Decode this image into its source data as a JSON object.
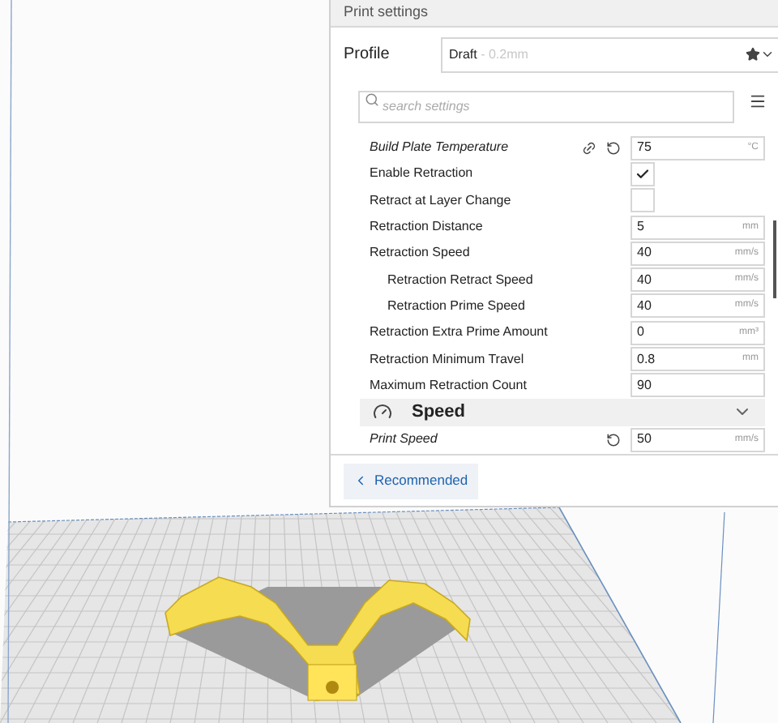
{
  "panel": {
    "title": "Print settings",
    "profile": {
      "label": "Profile",
      "name": "Draft",
      "detail": " - 0.2mm"
    },
    "search": {
      "placeholder": "search settings"
    },
    "settings": [
      {
        "kind": "number",
        "label": "Build Plate Temperature",
        "modified": true,
        "linked": true,
        "resettable": true,
        "value": "75",
        "unit": "°C"
      },
      {
        "kind": "checkbox",
        "label": "Enable Retraction",
        "modified": false,
        "checked": true
      },
      {
        "kind": "checkbox",
        "label": "Retract at Layer Change",
        "modified": false,
        "checked": false
      },
      {
        "kind": "number",
        "label": "Retraction Distance",
        "modified": false,
        "value": "5",
        "unit": "mm"
      },
      {
        "kind": "number",
        "label": "Retraction Speed",
        "modified": false,
        "value": "40",
        "unit": "mm/s",
        "children": [
          {
            "kind": "number",
            "label": "Retraction Retract Speed",
            "modified": false,
            "value": "40",
            "unit": "mm/s"
          },
          {
            "kind": "number",
            "label": "Retraction Prime Speed",
            "modified": false,
            "value": "40",
            "unit": "mm/s"
          }
        ]
      },
      {
        "kind": "number",
        "label": "Retraction Extra Prime Amount",
        "modified": false,
        "value": "0",
        "unit": "mm³"
      },
      {
        "kind": "number",
        "label": "Retraction Minimum Travel",
        "modified": false,
        "value": "0.8",
        "unit": "mm"
      },
      {
        "kind": "number",
        "label": "Maximum Retraction Count",
        "modified": false,
        "value": "90"
      },
      {
        "kind": "category",
        "label": "Speed",
        "expanded": true
      },
      {
        "kind": "number",
        "label": "Print Speed",
        "modified": true,
        "resettable": true,
        "value": "50",
        "unit": "mm/s"
      }
    ],
    "mode_button": "Recommended"
  }
}
